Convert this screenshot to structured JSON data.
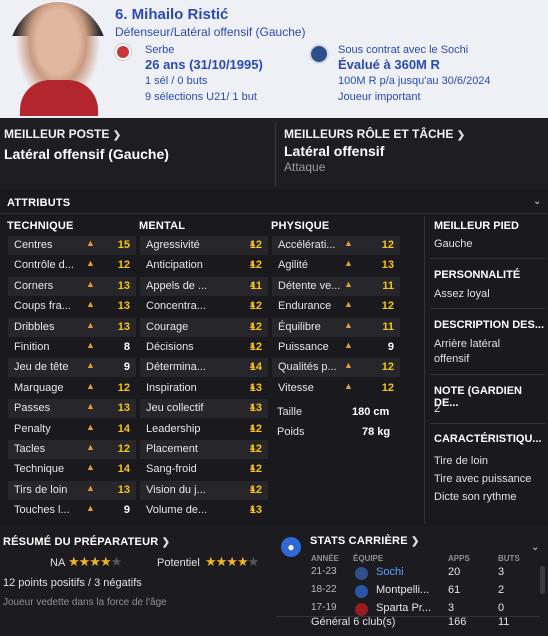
{
  "player": {
    "name": "6. Mihailo Ristić",
    "position": "Défenseur/Latéral offensif (Gauche)",
    "nationality": "Serbe",
    "age": "26 ans (31/10/1995)",
    "caps": "1 sél / 0 buts",
    "u21": "9 sélections U21/ 1 but",
    "contract": "Sous contrat avec le Sochi",
    "value": "Évalué à 360M R",
    "wage": "100M R p/a jusqu'au 30/6/2024",
    "status": "Joueur important"
  },
  "best_position": {
    "title": "MEILLEUR POSTE",
    "value": "Latéral offensif (Gauche)"
  },
  "best_role": {
    "title": "MEILLEURS RÔLE ET TÂCHE",
    "value": "Latéral offensif",
    "duty": "Attaque"
  },
  "attributes": {
    "title": "ATTRIBUTS",
    "technique_title": "TECHNIQUE",
    "mental_title": "MENTAL",
    "physique_title": "PHYSIQUE",
    "technique": [
      {
        "label": "Centres",
        "value": "15"
      },
      {
        "label": "Contrôle d...",
        "value": "12"
      },
      {
        "label": "Corners",
        "value": "13"
      },
      {
        "label": "Coups fra...",
        "value": "13"
      },
      {
        "label": "Dribbles",
        "value": "13"
      },
      {
        "label": "Finition",
        "value": "8"
      },
      {
        "label": "Jeu de tête",
        "value": "9"
      },
      {
        "label": "Marquage",
        "value": "12"
      },
      {
        "label": "Passes",
        "value": "13"
      },
      {
        "label": "Penalty",
        "value": "14"
      },
      {
        "label": "Tacles",
        "value": "12"
      },
      {
        "label": "Technique",
        "value": "14"
      },
      {
        "label": "Tirs de loin",
        "value": "13"
      },
      {
        "label": "Touches l...",
        "value": "9"
      }
    ],
    "mental": [
      {
        "label": "Agressivité",
        "value": "12"
      },
      {
        "label": "Anticipation",
        "value": "12"
      },
      {
        "label": "Appels de ...",
        "value": "11"
      },
      {
        "label": "Concentra...",
        "value": "12"
      },
      {
        "label": "Courage",
        "value": "12"
      },
      {
        "label": "Décisions",
        "value": "12"
      },
      {
        "label": "Détermina...",
        "value": "14"
      },
      {
        "label": "Inspiration",
        "value": "13"
      },
      {
        "label": "Jeu collectif",
        "value": "13"
      },
      {
        "label": "Leadership",
        "value": "12"
      },
      {
        "label": "Placement",
        "value": "12"
      },
      {
        "label": "Sang-froid",
        "value": "12"
      },
      {
        "label": "Vision du j...",
        "value": "12"
      },
      {
        "label": "Volume de...",
        "value": "13"
      }
    ],
    "physique": [
      {
        "label": "Accélérati...",
        "value": "12"
      },
      {
        "label": "Agilité",
        "value": "13"
      },
      {
        "label": "Détente ve...",
        "value": "11"
      },
      {
        "label": "Endurance",
        "value": "12"
      },
      {
        "label": "Équilibre",
        "value": "11"
      },
      {
        "label": "Puissance",
        "value": "9"
      },
      {
        "label": "Qualités p...",
        "value": "12"
      },
      {
        "label": "Vitesse",
        "value": "12"
      }
    ],
    "height_label": "Taille",
    "height": "180 cm",
    "weight_label": "Poids",
    "weight": "78 kg"
  },
  "side": {
    "foot_title": "MEILLEUR PIED",
    "foot": "Gauche",
    "personality_title": "PERSONNALITÉ",
    "personality": "Assez loyal",
    "description_title": "DESCRIPTION DES...",
    "description": "Arrière latéral offensif",
    "note_title": "NOTE (GARDIEN DE...",
    "note": "2",
    "traits_title": "CARACTÉRISTIQU...",
    "traits": [
      "Tire de loin",
      "Tire avec puissance",
      "Dicte son rythme"
    ]
  },
  "coach": {
    "title": "RÉSUMÉ DU PRÉPARATEUR",
    "na_label": "NA",
    "na_stars": 4,
    "potential_label": "Potentiel",
    "potential_stars": 4,
    "points": "12 points positifs / 3 négatifs",
    "summary": "Joueur vedette dans la force de l'âge"
  },
  "career": {
    "title": "STATS CARRIÈRE",
    "col_year": "ANNÉE",
    "col_team": "ÉQUIPE",
    "col_apps": "APPS",
    "col_goals": "BUTS",
    "rows": [
      {
        "year": "21-23",
        "team": "Sochi",
        "apps": "20",
        "goals": "3"
      },
      {
        "year": "18-22",
        "team": "Montpelli...",
        "apps": "61",
        "goals": "2"
      },
      {
        "year": "17-19",
        "team": "Sparta Pr...",
        "apps": "3",
        "goals": "0"
      }
    ],
    "total_label": "Général 6 club(s)",
    "total_apps": "166",
    "total_goals": "11"
  },
  "colors": {
    "accent_blue": "#2a4bb5",
    "highlight_yellow": "#f5c518",
    "arrow_orange": "#e99a3a",
    "star": "#f0b429"
  }
}
